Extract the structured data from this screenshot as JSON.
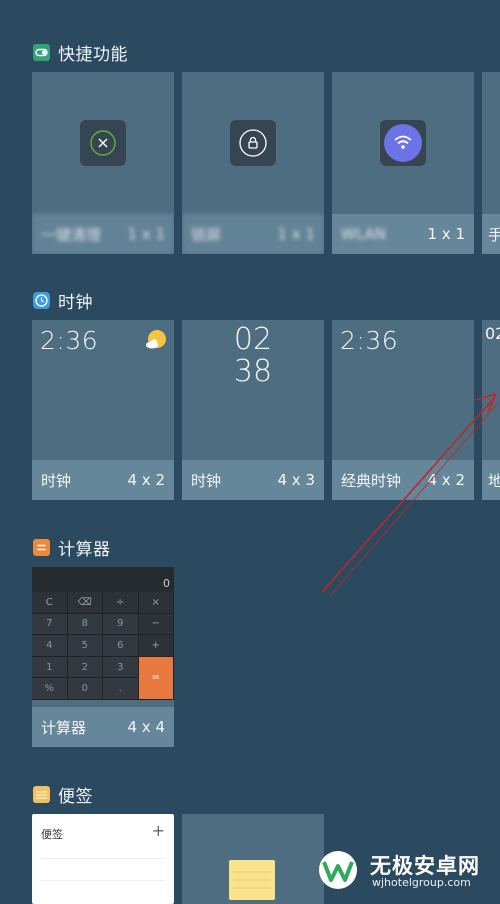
{
  "sections": {
    "quick": {
      "title": "快捷功能",
      "cards": [
        {
          "label": "一键清理",
          "size": "1 x 1"
        },
        {
          "label": "锁屏",
          "size": "1 x 1"
        },
        {
          "label": "WLAN",
          "size": "1 x 1"
        },
        {
          "label": "手"
        }
      ]
    },
    "clock": {
      "title": "时钟",
      "cards": [
        {
          "time": "2:36",
          "label": "时钟",
          "size": "4 x 2"
        },
        {
          "hour": "02",
          "minute": "38",
          "label": "时钟",
          "size": "4 x 3"
        },
        {
          "time": "2:36",
          "label": "经典时钟",
          "size": "4 x 2"
        },
        {
          "time": "02",
          "label": "地"
        }
      ]
    },
    "calculator": {
      "title": "计算器",
      "display": "0",
      "keys": [
        "C",
        "⌫",
        "÷",
        "×",
        "7",
        "8",
        "9",
        "−",
        "4",
        "5",
        "6",
        "+",
        "1",
        "2",
        "3",
        "=",
        "%",
        "0",
        "."
      ],
      "card": {
        "label": "计算器",
        "size": "4 x 4"
      }
    },
    "notes": {
      "title": "便签",
      "card": {
        "title": "便签",
        "plus": "+"
      }
    }
  },
  "watermark": {
    "name": "无极安卓网",
    "url": "wjhotelgroup.com"
  },
  "colors": {
    "background": "#2c4a5f",
    "card": "#4e6d81",
    "footer": "#66869a",
    "arrow": "#c0262b",
    "calc_accent": "#e97a3f"
  }
}
